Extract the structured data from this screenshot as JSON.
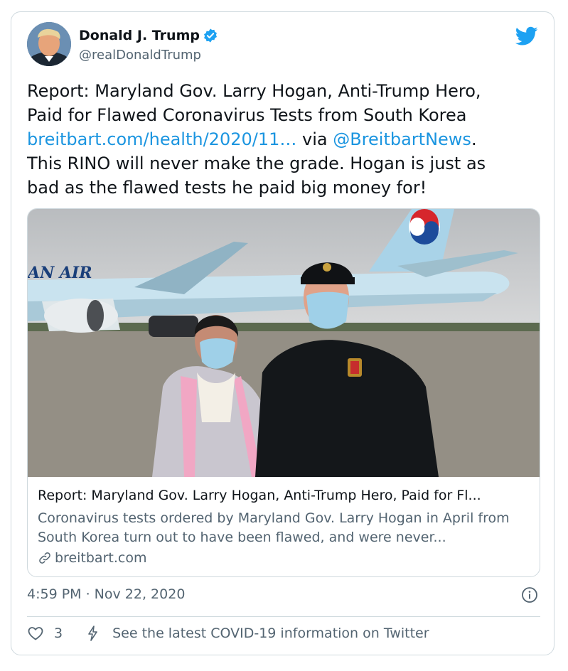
{
  "author": {
    "display_name": "Donald J. Trump",
    "handle": "@realDonaldTrump",
    "verified": true
  },
  "tweet": {
    "text_line1": "Report: Maryland Gov. Larry Hogan, Anti-Trump Hero,",
    "text_line2": "Paid for Flawed Coronavirus Tests from South Korea",
    "link_url": "breitbart.com/health/2020/11…",
    "via": " via ",
    "mention": "@BreitbartNews",
    "text_line3_end": ".",
    "text_line4": "This RINO will never make the grade. Hogan is just as",
    "text_line5": "bad as the flawed tests he paid big money for!"
  },
  "card": {
    "image_text": "AN AIR",
    "title": "Report: Maryland Gov. Larry Hogan, Anti-Trump Hero, Paid for Fl...",
    "description": "Coronavirus tests ordered by Maryland Gov. Larry Hogan in April from South Korea turn out to have been flawed, and were never...",
    "domain": "breitbart.com"
  },
  "meta": {
    "timestamp": "4:59 PM · Nov 22, 2020"
  },
  "actions": {
    "like_count": "3",
    "covid_notice": "See the latest COVID-19 information on Twitter"
  },
  "icons": {
    "twitter": "twitter-bird-icon",
    "verified": "verified-badge-icon",
    "info": "info-icon",
    "like": "heart-icon",
    "covid": "lightning-icon",
    "link": "link-icon"
  },
  "colors": {
    "link": "#1b95e0",
    "twitter_blue": "#1da1f2",
    "secondary_text": "#536471",
    "border": "#cfd9de"
  }
}
